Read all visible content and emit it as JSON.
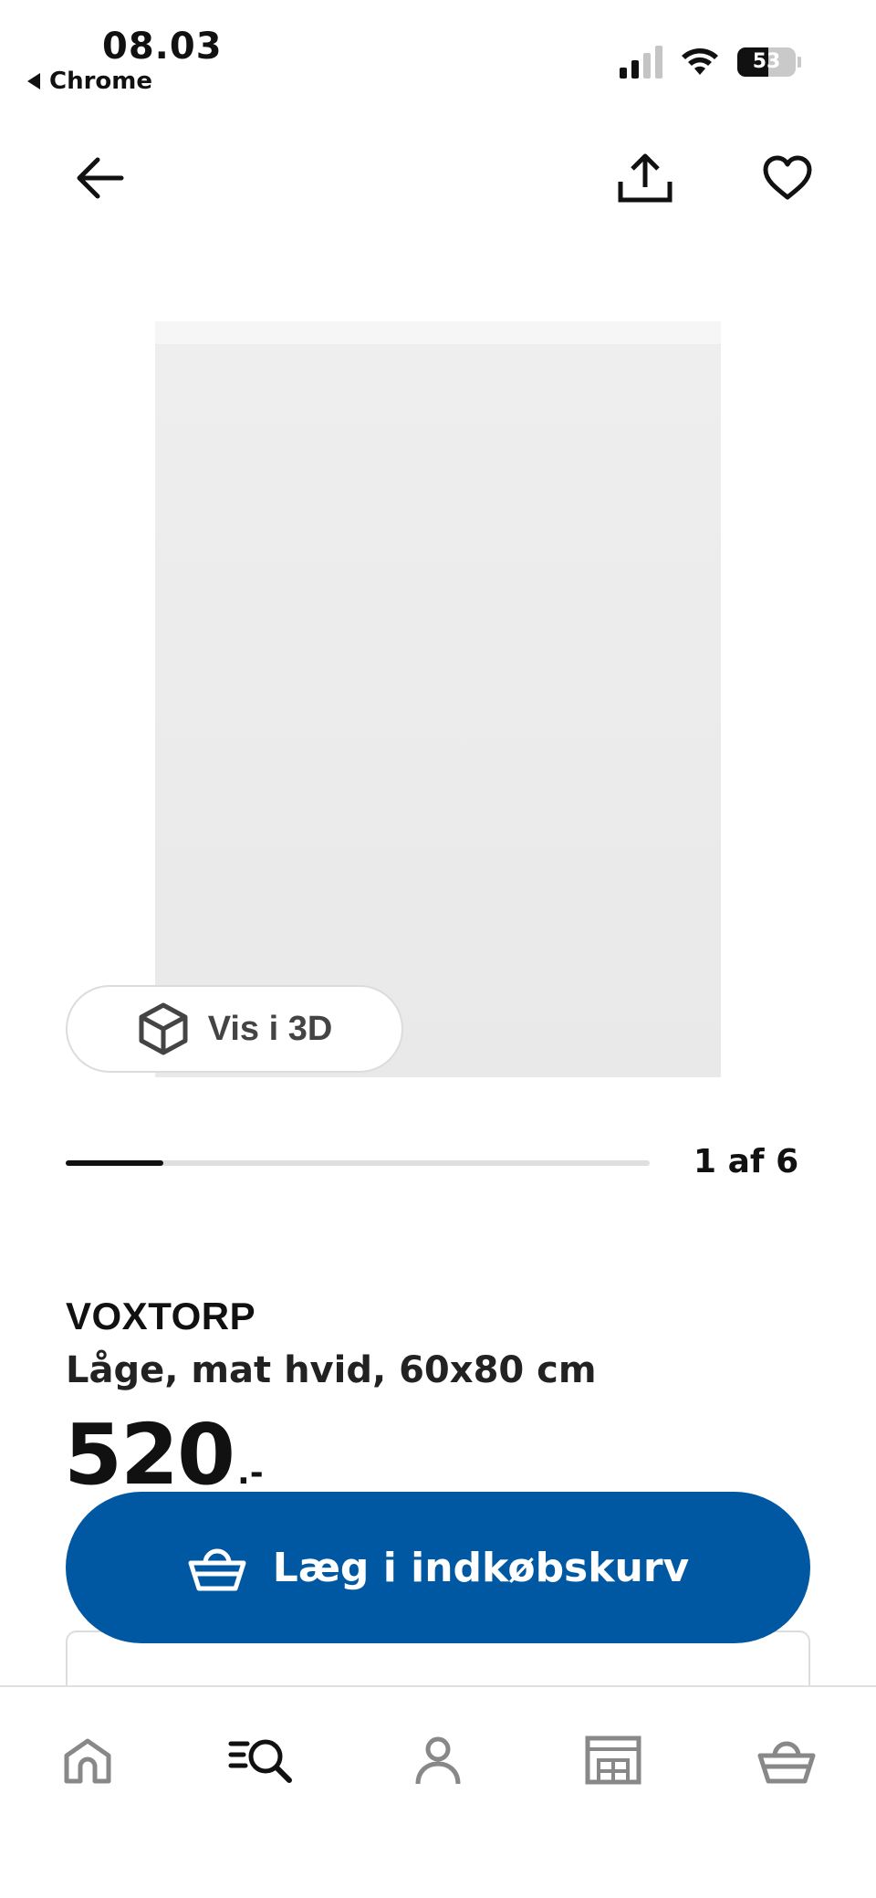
{
  "status_bar": {
    "time": "08.03",
    "back_app": "Chrome",
    "battery_level": "53",
    "battery_fraction": 0.53,
    "signal_bars_active": 2,
    "signal_bars_total": 4
  },
  "top_nav": {
    "back_icon": "arrow-left-icon",
    "share_icon": "share-icon",
    "favorite_icon": "heart-icon"
  },
  "gallery": {
    "view_3d_label": "Vis i 3D",
    "view_3d_icon": "cube-icon",
    "page_counter": "1 af 6",
    "current_index": 1,
    "total_images": 6
  },
  "product": {
    "name": "VOXTORP",
    "description": "Låge, mat hvid, 60x80 cm",
    "price": "520",
    "price_suffix": ".-"
  },
  "add_to_cart": {
    "label": "Læg i indkøbskurv",
    "icon": "basket-icon",
    "color": "#0058a3"
  },
  "tab_bar": {
    "items": [
      {
        "icon": "home-icon",
        "active": false
      },
      {
        "icon": "search-icon",
        "active": true
      },
      {
        "icon": "profile-icon",
        "active": false
      },
      {
        "icon": "store-icon",
        "active": false
      },
      {
        "icon": "basket-icon",
        "active": false
      }
    ]
  }
}
